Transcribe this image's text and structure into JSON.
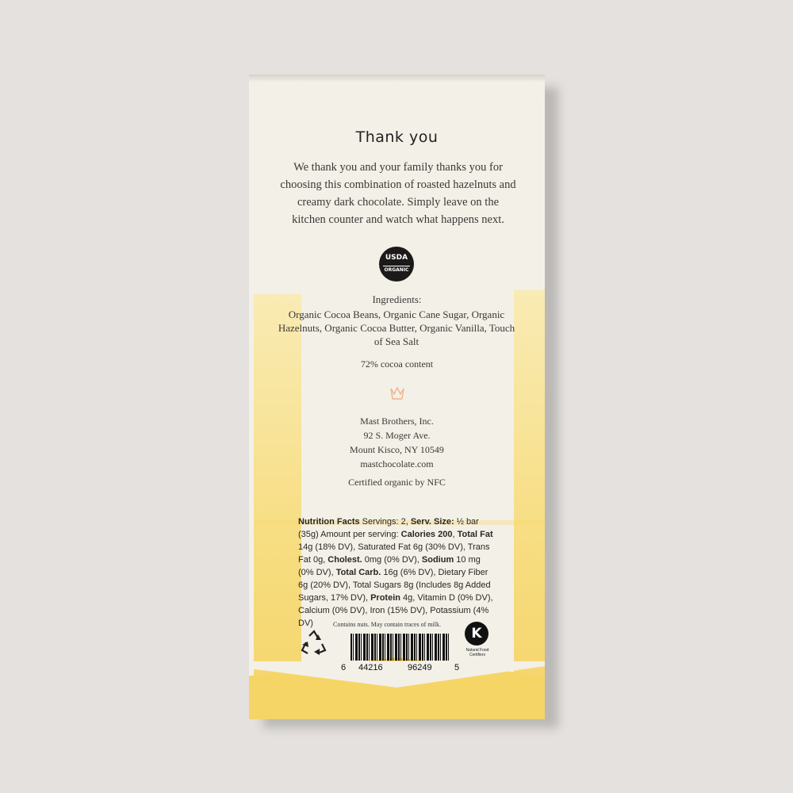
{
  "package": {
    "title": "Thank you",
    "intro": "We thank you and your family thanks you for choosing this combination of roasted hazelnuts and creamy dark chocolate. Simply leave on the kitchen counter and watch what happens next.",
    "usda_seal": {
      "line1": "USDA",
      "line2": "ORGANIC",
      "icon": "usda-organic-seal-icon"
    },
    "ingredients_heading": "Ingredients:",
    "ingredients": "Organic Cocoa Beans, Organic Cane Sugar, Organic Hazelnuts, Organic Cocoa Butter, Organic Vanilla, Touch of Sea Salt",
    "cocoa_content": "72%  cocoa content",
    "crown_icon": "crown-logo-icon",
    "address": [
      "Mast Brothers, Inc.",
      "92 S. Moger Ave.",
      "Mount Kisco, NY 10549",
      "mastchocolate.com"
    ],
    "certified": "Certified organic by NFC",
    "nutrition": {
      "label": "Nutrition Facts",
      "servings": " Servings: 2, ",
      "serv_size_label": "Serv. Size:",
      "serv_size_value": " ½ bar (35g)",
      "amount": "Amount per serving: ",
      "calories": "Calories 200",
      "total_fat_label": "Total Fat",
      "total_fat_value": " 14g (18% DV), Saturated Fat 6g (30% DV), Trans Fat 0g, ",
      "cholest_label": "Cholest.",
      "cholest_value": " 0mg (0% DV), ",
      "sodium_label": "Sodium",
      "sodium_value": " 10 mg (0% DV), ",
      "carb_label": "Total Carb.",
      "carb_value": " 16g (6% DV), Dietary Fiber 6g (20% DV), Total Sugars 8g (Includes 8g Added Sugars, 17% DV), ",
      "protein_label": "Protein",
      "protein_value": " 4g, Vitamin D (0% DV), Calcium (0% DV), Iron (15% DV), Potassium (4% DV)"
    },
    "allergen": "Contains nuts. May contain traces of milk.",
    "recycle_icon": "recycle-icon",
    "barcode": {
      "d1": "6",
      "d2": "44216",
      "d3": "96249",
      "d4": "5"
    },
    "kosher": {
      "letter": "K",
      "caption": "Natural Food Certifiers"
    },
    "colors": {
      "background": "#e4e1de",
      "paper": "#f3f0e8",
      "yellow": "#f6d567"
    }
  }
}
